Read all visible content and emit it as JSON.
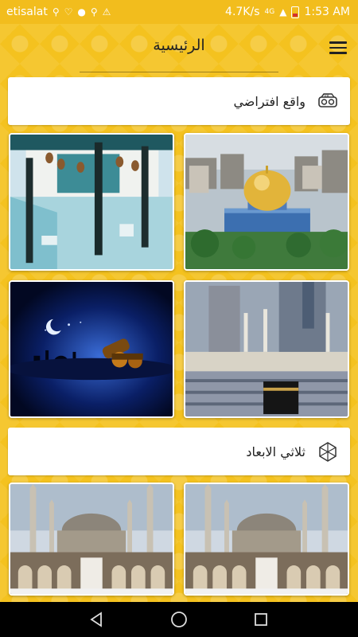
{
  "status_bar": {
    "carrier": "etisalat",
    "speed": "4.7K/s",
    "network": "4G",
    "time": "1:53 AM"
  },
  "app_bar": {
    "title": "الرئيسية"
  },
  "sections": [
    {
      "label": "واقع افتراضي",
      "icon": "vr-headset-icon"
    },
    {
      "label": "ثلاثي الابعاد",
      "icon": "3d-cube-icon"
    }
  ],
  "tiles": [
    {
      "subject": "dome-of-the-rock"
    },
    {
      "subject": "cave-interior"
    },
    {
      "subject": "kaaba-mecca"
    },
    {
      "subject": "ramadan-cannon"
    },
    {
      "subject": "blue-mosque"
    },
    {
      "subject": "blue-mosque"
    }
  ],
  "colors": {
    "background": "#f4c21f",
    "status_bar": "#f2bd1d",
    "card": "#ffffff",
    "nav_bar": "#000000"
  }
}
